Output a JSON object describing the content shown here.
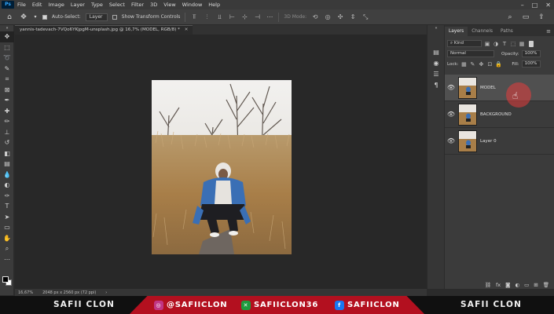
{
  "menubar": {
    "app_logo": "Ps",
    "items": [
      "File",
      "Edit",
      "Image",
      "Layer",
      "Type",
      "Select",
      "Filter",
      "3D",
      "View",
      "Window",
      "Help"
    ]
  },
  "options_bar": {
    "auto_select_label": "Auto-Select:",
    "auto_select_target": "Layer",
    "show_transform_label": "Show Transform Controls",
    "mode_3d_label": "3D Mode:"
  },
  "document": {
    "tab_title": "yannis-tadevach-7VQo6YKjpgM-unsplash.jpg @ 16,7% (MODEL, RGB/8) *",
    "zoom": "16,67%",
    "dimensions": "2048 px x 2560 px (72 ppi)"
  },
  "layers_panel": {
    "tabs": [
      "Layers",
      "Channels",
      "Paths"
    ],
    "filter_kind": "Kind",
    "blend_mode": "Normal",
    "opacity_label": "Opacity:",
    "opacity_value": "100%",
    "lock_label": "Lock:",
    "fill_label": "Fill:",
    "fill_value": "100%",
    "layers": [
      {
        "name": "MODEL",
        "selected": true
      },
      {
        "name": "BACKGROUND",
        "selected": false
      },
      {
        "name": "Layer 0",
        "selected": false
      }
    ]
  },
  "banner": {
    "left_brand": "SAFII CLON",
    "right_brand": "SAFII CLON",
    "instagram": "@SAFIICLON",
    "x_handle": "SAFIICLON36",
    "facebook": "SAFIICLON"
  },
  "colors": {
    "accent_red": "#d0152a",
    "panel_bg": "#3b3b3b",
    "canvas_bg": "#282828"
  }
}
